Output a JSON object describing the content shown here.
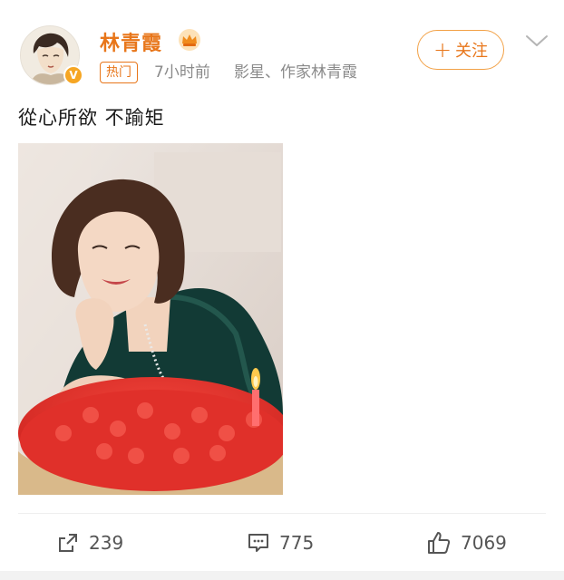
{
  "user": {
    "name": "林青霞",
    "hot_label": "热门",
    "time_ago": "7小时前",
    "description": "影星、作家林青霞",
    "verified": true
  },
  "follow_button": {
    "label": "关注"
  },
  "post": {
    "text": "從心所欲 不踰矩",
    "image_alt": "photo of a smiling woman leaning on her hand beside a red rose cake with a lit candle"
  },
  "actions": {
    "share_count": "239",
    "comment_count": "775",
    "like_count": "7069"
  },
  "icons": {
    "verified": "verified-v-icon",
    "crown": "crown-icon",
    "chevron": "chevron-down-icon",
    "share": "share-icon",
    "comment": "comment-icon",
    "like": "thumbs-up-icon"
  },
  "colors": {
    "accent": "#e8761a",
    "muted": "#8a8a8a",
    "verified": "#f6a623"
  }
}
